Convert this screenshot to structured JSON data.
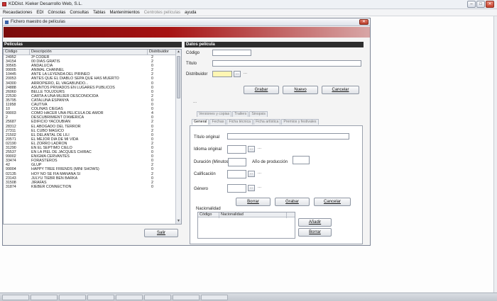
{
  "app": {
    "title": "KDDist. Kieker Desarrollo Web, S.L.",
    "controls": [
      "–",
      "□",
      "✕"
    ]
  },
  "menu": {
    "items": [
      {
        "label": "Recaudaciones",
        "disabled": false
      },
      {
        "label": "EDI",
        "disabled": false
      },
      {
        "label": "Cónsolas",
        "disabled": false
      },
      {
        "label": "Consultas",
        "disabled": false
      },
      {
        "label": "Tablas",
        "disabled": false
      },
      {
        "label": "Mantenimientos",
        "disabled": false
      },
      {
        "label": "Centrotes películas",
        "disabled": true
      },
      {
        "label": "ayuda",
        "disabled": false
      }
    ]
  },
  "window": {
    "title": "Fichero maestro de películas",
    "close": "✕"
  },
  "list": {
    "header": "Películas",
    "columns": {
      "code": "Código",
      "description": "Descripción",
      "distributor": "Distribuidor"
    },
    "rows": [
      {
        "code": "24952",
        "description": "3ª CODER",
        "dist": "2"
      },
      {
        "code": "34154",
        "description": "00 DIAS GRATIS",
        "dist": "2"
      },
      {
        "code": "30565",
        "description": "ANDALUCIA",
        "dist": "0"
      },
      {
        "code": "99005",
        "description": "ANIMAL CHANNEL",
        "dist": "2"
      },
      {
        "code": "10445",
        "description": "ANTE LA LEYENDA DEL PIRINEO",
        "dist": "2"
      },
      {
        "code": "20053",
        "description": "ANTES QUE EL DIABLO SEPA QUE HAS MUERTO",
        "dist": "0"
      },
      {
        "code": "34300",
        "description": "ARROPIERO, EL VAGABUNDO...",
        "dist": "0"
      },
      {
        "code": "24888",
        "description": "ASUNTOS PRIVADOS EN LUGARES PÚBLICOS",
        "dist": "0"
      },
      {
        "code": "26060",
        "description": "BELLE TOUJOURS",
        "dist": "0"
      },
      {
        "code": "22530",
        "description": "CARTA A UNA MUJER DESCONOCIDA",
        "dist": "2"
      },
      {
        "code": "35795",
        "description": "CATALUÑA ESPANYA",
        "dist": "0"
      },
      {
        "code": "11958",
        "description": "CAUTIVA",
        "dist": "0"
      },
      {
        "code": "10",
        "description": "COLINAS CIEGAS",
        "dist": "0"
      },
      {
        "code": "99003",
        "description": "COMO HACER UNA PELICULA DE AMOR",
        "dist": "4"
      },
      {
        "code": "2",
        "description": "DESCUBRIMIENT D'AMERICA",
        "dist": "0"
      },
      {
        "code": "25687",
        "description": "EDIFICIO YACOUBIAN",
        "dist": "2"
      },
      {
        "code": "28312",
        "description": "EL ABOGADO DEL TERROR",
        "dist": "0"
      },
      {
        "code": "27311",
        "description": "EL CUBO MAGICO",
        "dist": "2"
      },
      {
        "code": "21502",
        "description": "EL DELANTAL DE LILI",
        "dist": "0"
      },
      {
        "code": "20571",
        "description": "EL MEJOR DIA DE MI VIDA",
        "dist": "0"
      },
      {
        "code": "02190",
        "description": "EL ZORRO LADRON",
        "dist": "2"
      },
      {
        "code": "31290",
        "description": "EN EL SEPTIMO CIELO",
        "dist": "0"
      },
      {
        "code": "25537",
        "description": "EN LA PIEL DE JACQUES CHIRAC",
        "dist": "0"
      },
      {
        "code": "99002",
        "description": "ENIGMA CERVANTES",
        "dist": "0"
      },
      {
        "code": "33474",
        "description": "FORASTEROS",
        "dist": "0"
      },
      {
        "code": "42",
        "description": "GLUP",
        "dist": "2"
      },
      {
        "code": "99004",
        "description": "HAPPY TREE FRIENDS (MINI SHOWS)",
        "dist": "0"
      },
      {
        "code": "02135",
        "description": "HOY NO SE FIA MAÑANA SI",
        "dist": "2"
      },
      {
        "code": "23143",
        "description": "JULYU TIEBR BEN BARKA",
        "dist": "0"
      },
      {
        "code": "31508",
        "description": "JIRAFAS",
        "dist": "2"
      },
      {
        "code": "31874",
        "description": "KIEBER CONNECTION",
        "dist": "0"
      }
    ],
    "exit_label": "Salir"
  },
  "detail": {
    "header": "Datos película",
    "code_label": "Código",
    "title_label": "Título",
    "distributor_label": "Distribuidor",
    "code_value": "",
    "title_value": "",
    "distributor_value": "",
    "dots_label": "...",
    "save_label": "Grabar",
    "new_label": "Nuevo",
    "cancel_label": "Cancelar",
    "ellipsis": "..."
  },
  "tabs": {
    "row1": [
      "Versiones y copias",
      "Trailers",
      "Sinopsis"
    ],
    "row2": [
      "General",
      "Fechas",
      "Ficha técnica",
      "Ficha artística",
      "Premios y festivales"
    ]
  },
  "general": {
    "original_title_label": "Título original",
    "original_language_label": "Idioma original",
    "duration_label": "Duración (Minutos)",
    "year_label": "Año de producción",
    "rating_label": "Calificación",
    "genre_label": "Género",
    "delete_label": "Borrar",
    "save_label": "Grabar",
    "cancel_label": "Cancelar",
    "nationality_label": "Nacionalidad",
    "grid_code": "Código",
    "grid_nationality": "Nacionalidad",
    "add_label": "Añadir",
    "remove_label": "Borrar",
    "dots_label": "...",
    "ellipsis": "..."
  }
}
